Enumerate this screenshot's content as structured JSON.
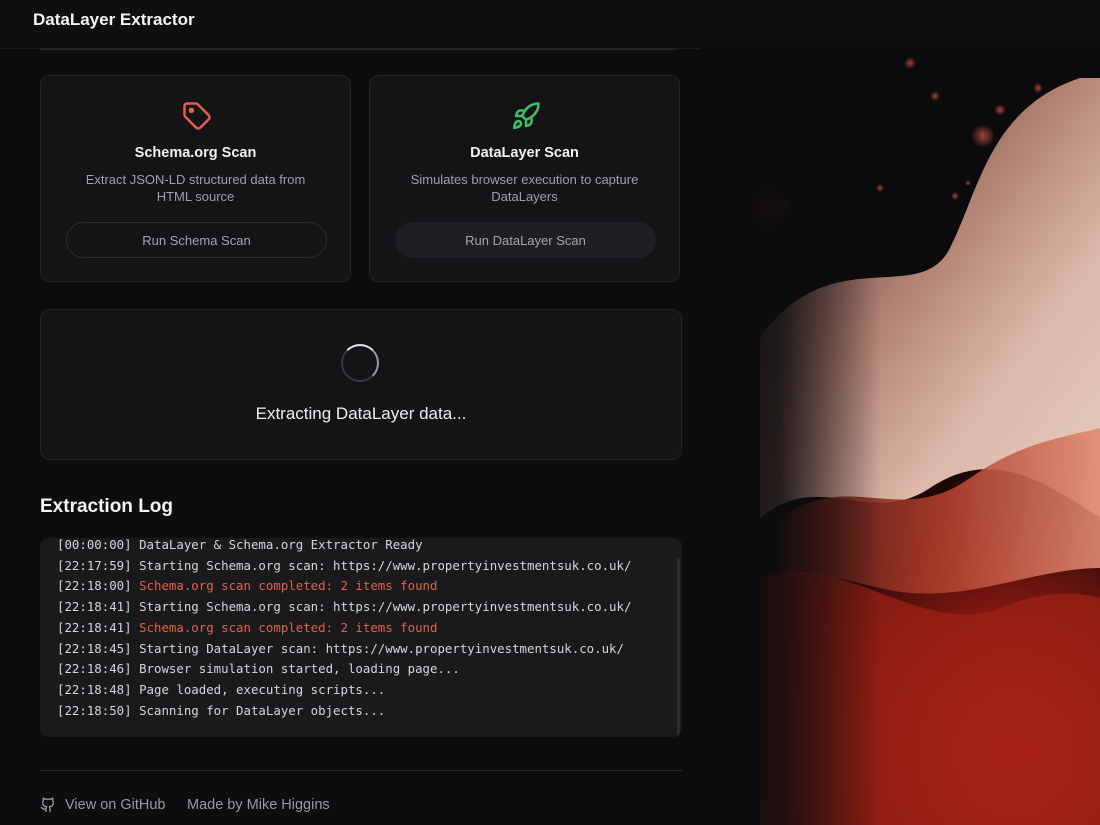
{
  "header": {
    "title": "DataLayer Extractor"
  },
  "cards": {
    "schema": {
      "icon": "tag-icon",
      "title": "Schema.org Scan",
      "description": "Extract JSON-LD structured data from HTML source",
      "button": "Run Schema Scan"
    },
    "datalayer": {
      "icon": "rocket-icon",
      "title": "DataLayer Scan",
      "description": "Simulates browser execution to capture DataLayers",
      "button": "Run DataLayer Scan"
    }
  },
  "loader": {
    "text": "Extracting DataLayer data..."
  },
  "log": {
    "heading": "Extraction Log",
    "lines": [
      {
        "time": "[00:00:00]",
        "message": "DataLayer & Schema.org Extractor Ready",
        "status": "info"
      },
      {
        "time": "[22:17:59]",
        "message": "Starting Schema.org scan: https://www.propertyinvestmentsuk.co.uk/",
        "status": "info"
      },
      {
        "time": "[22:18:00]",
        "message": "Schema.org scan completed: 2 items found",
        "status": "success"
      },
      {
        "time": "[22:18:41]",
        "message": "Starting Schema.org scan: https://www.propertyinvestmentsuk.co.uk/",
        "status": "info"
      },
      {
        "time": "[22:18:41]",
        "message": "Schema.org scan completed: 2 items found",
        "status": "success"
      },
      {
        "time": "[22:18:45]",
        "message": "Starting DataLayer scan: https://www.propertyinvestmentsuk.co.uk/",
        "status": "info"
      },
      {
        "time": "[22:18:46]",
        "message": "Browser simulation started, loading page...",
        "status": "info"
      },
      {
        "time": "[22:18:48]",
        "message": "Page loaded, executing scripts...",
        "status": "info"
      },
      {
        "time": "[22:18:50]",
        "message": "Scanning for DataLayer objects...",
        "status": "info"
      }
    ]
  },
  "footer": {
    "github_icon": "github-icon",
    "github_link": "View on GitHub",
    "made_by": "Made by Mike Higgins"
  },
  "colors": {
    "background": "#0d0c0e",
    "card": "#141316",
    "tag_icon": "#e5604a",
    "rocket_icon": "#3fbf6a",
    "log_success": "#e0634a"
  }
}
